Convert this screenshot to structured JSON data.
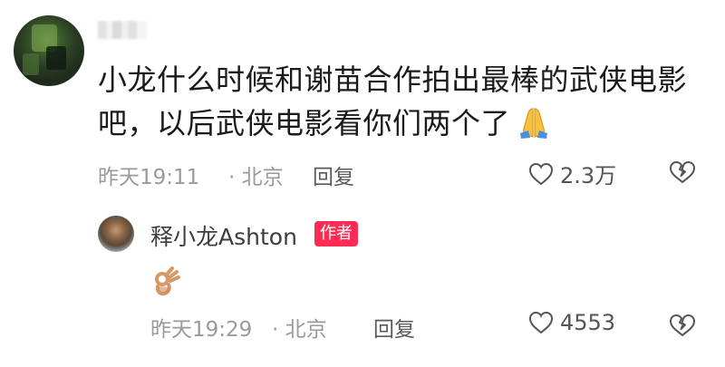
{
  "comment": {
    "text_line1": "小龙什么时候和谢苗合作拍出最棒的武侠电影",
    "text_line2": "吧，以后武侠电影看你们两个了",
    "emoji": "folded-hands-icon",
    "time": "昨天19:11",
    "location": "· 北京",
    "reply_label": "回复",
    "like_count": "2.3万"
  },
  "reply": {
    "author": "释小龙Ashton",
    "badge": "作者",
    "emoji": "ok-hand-icon",
    "time": "昨天19:29",
    "location": "· 北京",
    "reply_label": "回复",
    "like_count": "4553"
  },
  "colors": {
    "badge_bg": "#fe2c55",
    "meta_gray": "#9a9a9a",
    "text": "#1a1a1a"
  }
}
